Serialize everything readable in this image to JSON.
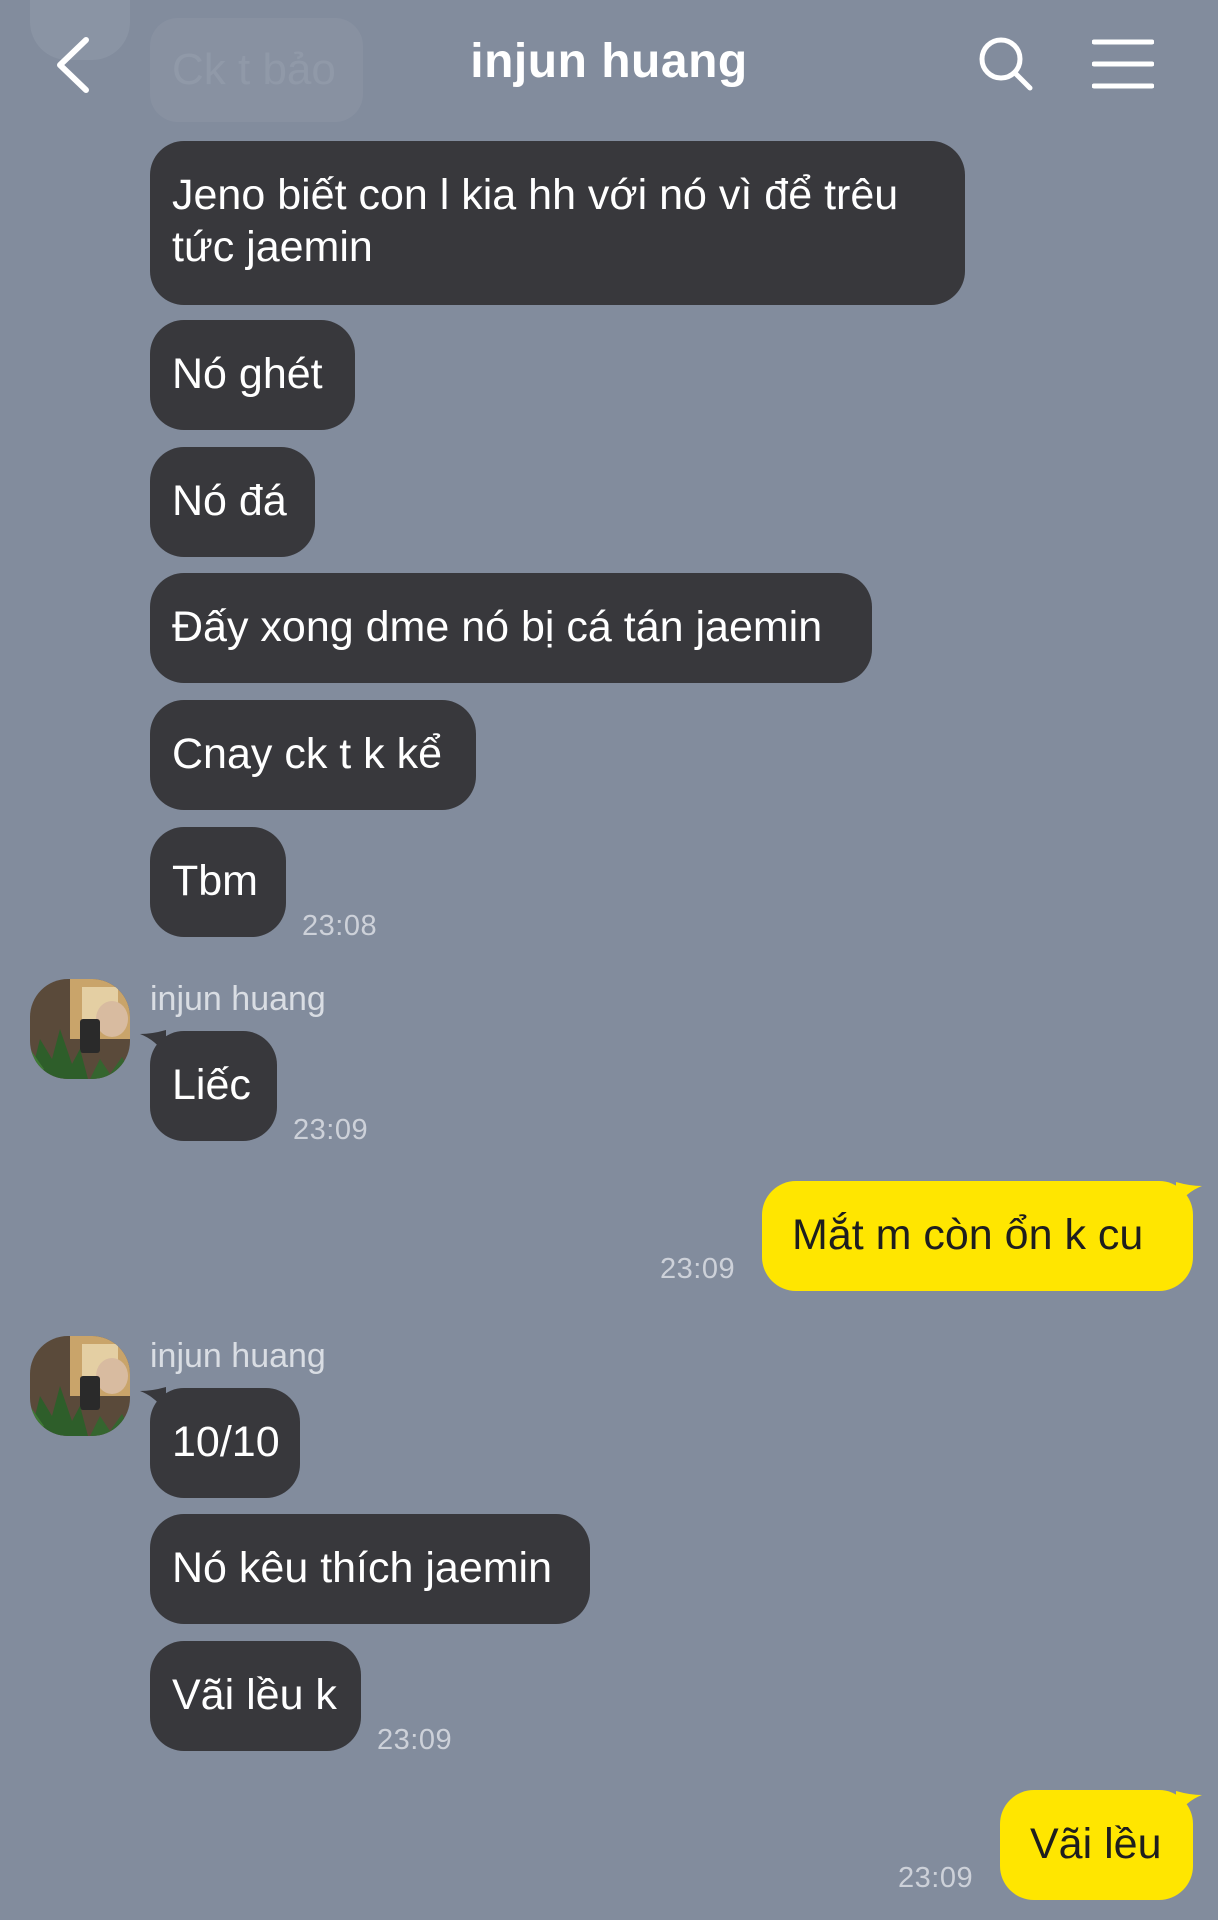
{
  "header": {
    "title": "injun huang",
    "back_icon": "chevron-left-icon",
    "search_icon": "search-icon",
    "menu_icon": "hamburger-menu-icon"
  },
  "ghost_message": {
    "text": "Ck t bảo"
  },
  "messages": [
    {
      "text_line1": "Jeno biết con l kia hh với nó vì để trêu",
      "text_line2": "tức jaemin"
    },
    {
      "text": "Nó ghét"
    },
    {
      "text": "Nó đá"
    },
    {
      "text": "Đấy xong dme nó bị cá tán jaemin"
    },
    {
      "text": "Cnay ck t k kể"
    },
    {
      "text": "Tbm",
      "time": "23:08"
    },
    {
      "sender": "injun huang",
      "text": "Liếc",
      "time": "23:09"
    },
    {
      "text": "Mắt m còn ổn k cu",
      "time": "23:09"
    },
    {
      "sender": "injun huang",
      "text": "10/10"
    },
    {
      "text": "Nó kêu thích jaemin"
    },
    {
      "text": "Vãi lều k",
      "time": "23:09"
    },
    {
      "text": "Vãi lều",
      "time": "23:09"
    }
  ],
  "colors": {
    "background": "#828C9D",
    "incoming_bubble": "#38383C",
    "outgoing_bubble": "#FFE600"
  }
}
